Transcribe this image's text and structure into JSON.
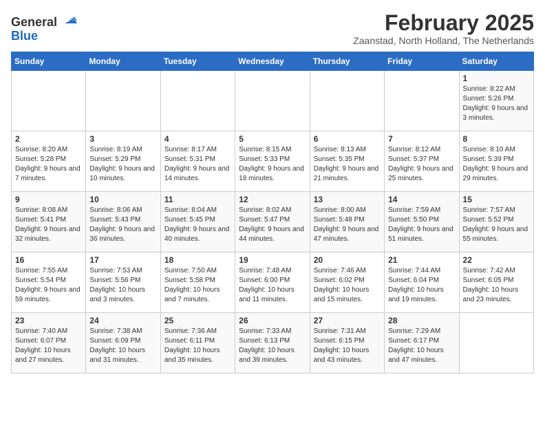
{
  "header": {
    "logo": {
      "general": "General",
      "blue": "Blue"
    },
    "title": "February 2025",
    "subtitle": "Zaanstad, North Holland, The Netherlands"
  },
  "weekdays": [
    "Sunday",
    "Monday",
    "Tuesday",
    "Wednesday",
    "Thursday",
    "Friday",
    "Saturday"
  ],
  "weeks": [
    [
      {
        "day": "",
        "info": ""
      },
      {
        "day": "",
        "info": ""
      },
      {
        "day": "",
        "info": ""
      },
      {
        "day": "",
        "info": ""
      },
      {
        "day": "",
        "info": ""
      },
      {
        "day": "",
        "info": ""
      },
      {
        "day": "1",
        "info": "Sunrise: 8:22 AM\nSunset: 5:26 PM\nDaylight: 9 hours and 3 minutes."
      }
    ],
    [
      {
        "day": "2",
        "info": "Sunrise: 8:20 AM\nSunset: 5:28 PM\nDaylight: 9 hours and 7 minutes."
      },
      {
        "day": "3",
        "info": "Sunrise: 8:19 AM\nSunset: 5:29 PM\nDaylight: 9 hours and 10 minutes."
      },
      {
        "day": "4",
        "info": "Sunrise: 8:17 AM\nSunset: 5:31 PM\nDaylight: 9 hours and 14 minutes."
      },
      {
        "day": "5",
        "info": "Sunrise: 8:15 AM\nSunset: 5:33 PM\nDaylight: 9 hours and 18 minutes."
      },
      {
        "day": "6",
        "info": "Sunrise: 8:13 AM\nSunset: 5:35 PM\nDaylight: 9 hours and 21 minutes."
      },
      {
        "day": "7",
        "info": "Sunrise: 8:12 AM\nSunset: 5:37 PM\nDaylight: 9 hours and 25 minutes."
      },
      {
        "day": "8",
        "info": "Sunrise: 8:10 AM\nSunset: 5:39 PM\nDaylight: 9 hours and 29 minutes."
      }
    ],
    [
      {
        "day": "9",
        "info": "Sunrise: 8:08 AM\nSunset: 5:41 PM\nDaylight: 9 hours and 32 minutes."
      },
      {
        "day": "10",
        "info": "Sunrise: 8:06 AM\nSunset: 5:43 PM\nDaylight: 9 hours and 36 minutes."
      },
      {
        "day": "11",
        "info": "Sunrise: 8:04 AM\nSunset: 5:45 PM\nDaylight: 9 hours and 40 minutes."
      },
      {
        "day": "12",
        "info": "Sunrise: 8:02 AM\nSunset: 5:47 PM\nDaylight: 9 hours and 44 minutes."
      },
      {
        "day": "13",
        "info": "Sunrise: 8:00 AM\nSunset: 5:48 PM\nDaylight: 9 hours and 47 minutes."
      },
      {
        "day": "14",
        "info": "Sunrise: 7:59 AM\nSunset: 5:50 PM\nDaylight: 9 hours and 51 minutes."
      },
      {
        "day": "15",
        "info": "Sunrise: 7:57 AM\nSunset: 5:52 PM\nDaylight: 9 hours and 55 minutes."
      }
    ],
    [
      {
        "day": "16",
        "info": "Sunrise: 7:55 AM\nSunset: 5:54 PM\nDaylight: 9 hours and 59 minutes."
      },
      {
        "day": "17",
        "info": "Sunrise: 7:53 AM\nSunset: 5:56 PM\nDaylight: 10 hours and 3 minutes."
      },
      {
        "day": "18",
        "info": "Sunrise: 7:50 AM\nSunset: 5:58 PM\nDaylight: 10 hours and 7 minutes."
      },
      {
        "day": "19",
        "info": "Sunrise: 7:48 AM\nSunset: 6:00 PM\nDaylight: 10 hours and 11 minutes."
      },
      {
        "day": "20",
        "info": "Sunrise: 7:46 AM\nSunset: 6:02 PM\nDaylight: 10 hours and 15 minutes."
      },
      {
        "day": "21",
        "info": "Sunrise: 7:44 AM\nSunset: 6:04 PM\nDaylight: 10 hours and 19 minutes."
      },
      {
        "day": "22",
        "info": "Sunrise: 7:42 AM\nSunset: 6:05 PM\nDaylight: 10 hours and 23 minutes."
      }
    ],
    [
      {
        "day": "23",
        "info": "Sunrise: 7:40 AM\nSunset: 6:07 PM\nDaylight: 10 hours and 27 minutes."
      },
      {
        "day": "24",
        "info": "Sunrise: 7:38 AM\nSunset: 6:09 PM\nDaylight: 10 hours and 31 minutes."
      },
      {
        "day": "25",
        "info": "Sunrise: 7:36 AM\nSunset: 6:11 PM\nDaylight: 10 hours and 35 minutes."
      },
      {
        "day": "26",
        "info": "Sunrise: 7:33 AM\nSunset: 6:13 PM\nDaylight: 10 hours and 39 minutes."
      },
      {
        "day": "27",
        "info": "Sunrise: 7:31 AM\nSunset: 6:15 PM\nDaylight: 10 hours and 43 minutes."
      },
      {
        "day": "28",
        "info": "Sunrise: 7:29 AM\nSunset: 6:17 PM\nDaylight: 10 hours and 47 minutes."
      },
      {
        "day": "",
        "info": ""
      }
    ]
  ]
}
